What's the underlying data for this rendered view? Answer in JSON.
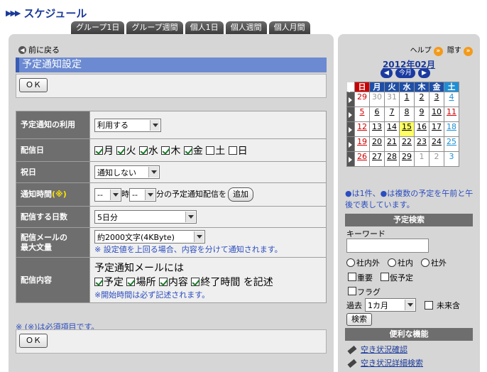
{
  "header": {
    "title": "スケジュール"
  },
  "tabs": [
    "グループ1日",
    "グループ週間",
    "個人1日",
    "個人週間",
    "個人月間"
  ],
  "main": {
    "back": "前に戻る",
    "title": "予定通知設定",
    "ok": "ＯＫ",
    "rows": {
      "use": {
        "label": "予定通知の利用",
        "value": "利用する"
      },
      "days": {
        "label": "配信日",
        "items": [
          {
            "l": "月",
            "c": true
          },
          {
            "l": "火",
            "c": true
          },
          {
            "l": "水",
            "c": true
          },
          {
            "l": "木",
            "c": true
          },
          {
            "l": "金",
            "c": true
          },
          {
            "l": "土",
            "c": false
          },
          {
            "l": "日",
            "c": false
          }
        ]
      },
      "holiday": {
        "label": "祝日",
        "value": "通知しない"
      },
      "time": {
        "label": "通知時間",
        "req": "(※)",
        "hour": "--",
        "hour_unit": "時",
        "min": "--",
        "tail": "分の予定通知配信を",
        "add": "追加"
      },
      "span": {
        "label": "配信する日数",
        "value": "5日分"
      },
      "maxlen": {
        "label1": "配信メールの",
        "label2": "最大文量",
        "value": "約2000文字(4KByte)",
        "note": "※ 設定値を上回る場合、内容を分けて通知されます。"
      },
      "content": {
        "label": "配信内容",
        "lead": "予定通知メールには",
        "items": [
          {
            "l": "予定",
            "c": true
          },
          {
            "l": "場所",
            "c": true
          },
          {
            "l": "内容",
            "c": true
          },
          {
            "l": "終了時間",
            "c": true
          }
        ],
        "tail": "を記述",
        "note": "※開始時間は必ず記述されます。"
      }
    },
    "required_note": "※ (※)は必須項目です。"
  },
  "side": {
    "help": "ヘルプ",
    "hide": "隠す",
    "month": "2012年02月",
    "nav": {
      "prev": "◀",
      "today": "今月",
      "next": "▶"
    },
    "weekdays": [
      "日",
      "月",
      "火",
      "水",
      "木",
      "金",
      "土"
    ],
    "weeks": [
      [
        "29",
        "30",
        "31",
        "1",
        "2",
        "3",
        "4"
      ],
      [
        "5",
        "6",
        "7",
        "8",
        "9",
        "10",
        "11"
      ],
      [
        "12",
        "13",
        "14",
        "15",
        "16",
        "17",
        "18"
      ],
      [
        "19",
        "20",
        "21",
        "22",
        "23",
        "24",
        "25"
      ],
      [
        "26",
        "27",
        "28",
        "29",
        "1",
        "2",
        "3"
      ]
    ],
    "legend": "●は1件、●は複数の予定を午前と午後で表しています。",
    "search_title": "予定検索",
    "keyword": "キーワード",
    "scope": [
      "社内外",
      "社内",
      "社外"
    ],
    "flags": [
      "重要",
      "仮予定",
      "フラグ"
    ],
    "past_label": "過去",
    "past_value": "1カ月",
    "future": "未来含",
    "search_btn": "検索",
    "tools_title": "便利な機能",
    "links": [
      "空き状況確認",
      "空き状況詳細検索"
    ]
  }
}
